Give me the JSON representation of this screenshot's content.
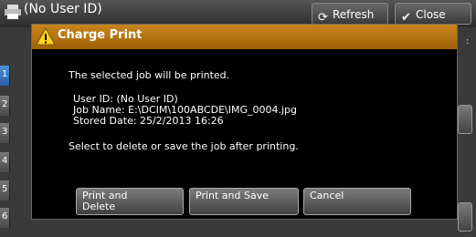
{
  "background": {
    "title": "(No User ID)",
    "refresh_label": "Refresh",
    "close_label": "Close",
    "colon": ":",
    "side_tabs": [
      "1",
      "2",
      "3",
      "4",
      "5",
      "6"
    ]
  },
  "dialog": {
    "title": "Charge Print",
    "message": "The selected job will be printed.",
    "user_id": "User ID: (No User ID)",
    "job_name": "Job Name: E:\\DCIM\\100ABCDE\\IMG_0004.jpg",
    "stored_date": "Stored Date: 25/2/2013 16:26",
    "prompt": "Select to delete or save the job after printing.",
    "buttons": {
      "print_and_delete_line1": "Print and",
      "print_and_delete_line2": "Delete",
      "print_and_save": "Print and Save",
      "cancel": "Cancel"
    }
  },
  "colors": {
    "title_bar": "#b8780f",
    "dialog_bg": "#000000",
    "selected_tab": "#3a7fd0"
  }
}
